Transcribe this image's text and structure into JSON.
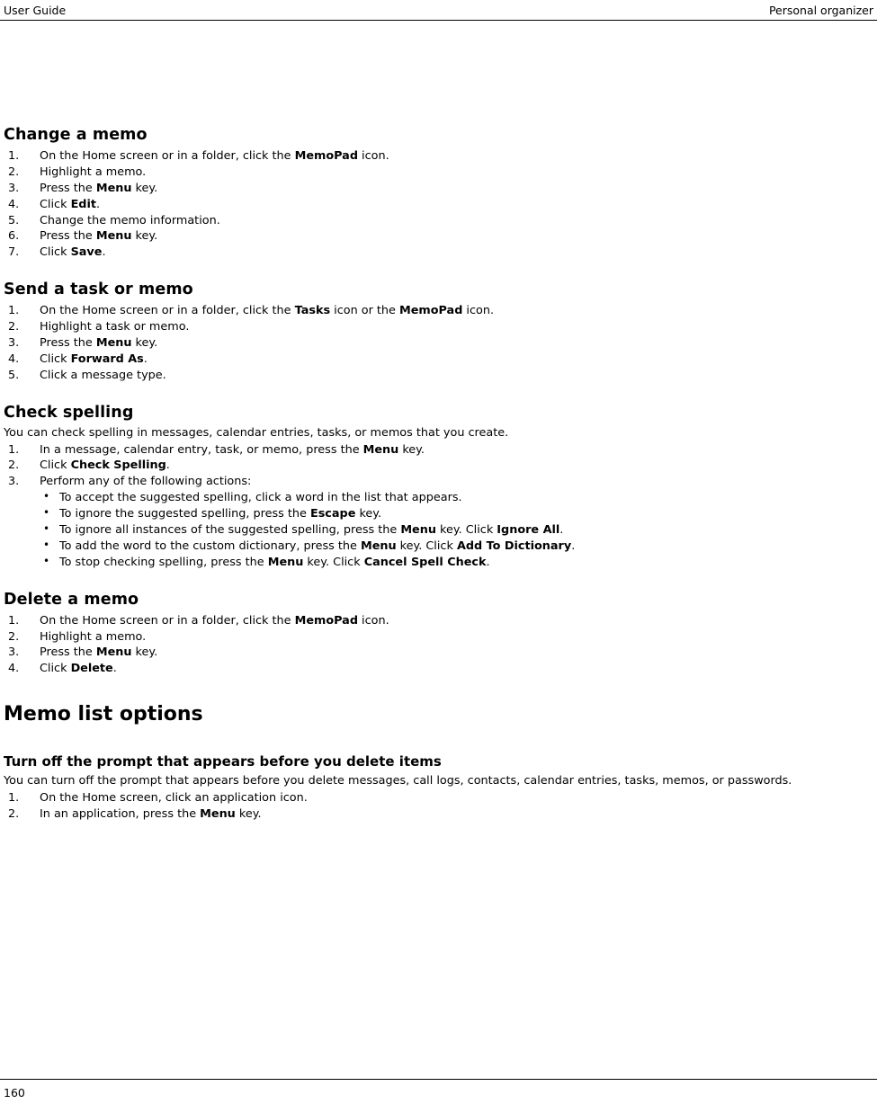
{
  "header": {
    "left": "User Guide",
    "right": "Personal organizer"
  },
  "footer": {
    "page_number": "160"
  },
  "sections": [
    {
      "id": "change_a_memo",
      "title": "Change a memo",
      "steps": [
        "On the Home screen or in a folder, click the MemoPad icon.",
        "Highlight a memo.",
        "Press the Menu key.",
        "Click Edit.",
        "Change the memo information.",
        "Press the Menu key.",
        "Click Save."
      ]
    },
    {
      "id": "send_a_task_or_memo",
      "title": "Send a task or memo",
      "steps": [
        "On the Home screen or in a folder, click the Tasks icon or the MemoPad icon.",
        "Highlight a task or memo.",
        "Press the Menu key.",
        "Click Forward As.",
        "Click a message type."
      ]
    },
    {
      "id": "check_spelling",
      "title": "Check spelling",
      "intro": "You can check spelling in messages, calendar entries, tasks, or memos that you create.",
      "steps": [
        "In a message, calendar entry, task, or memo, press the Menu key.",
        "Click Check Spelling.",
        "Perform any of the following actions:"
      ],
      "bullets": [
        "To accept the suggested spelling, click a word in the list that appears.",
        "To ignore the suggested spelling, press the Escape key.",
        "To ignore all instances of the suggested spelling, press the Menu key. Click Ignore All.",
        "To add the word to the custom dictionary, press the Menu key. Click Add To Dictionary.",
        "To stop checking spelling, press the Menu key. Click Cancel Spell Check."
      ]
    },
    {
      "id": "delete_a_memo",
      "title": "Delete a memo",
      "steps": [
        "On the Home screen or in a folder, click the MemoPad icon.",
        "Highlight a memo.",
        "Press the Menu key.",
        "Click Delete."
      ]
    }
  ],
  "major_section": {
    "title": "Memo list options",
    "subsection": {
      "title": "Turn off the prompt that appears before you delete items",
      "intro": "You can turn off the prompt that appears before you delete messages, call logs, contacts, calendar entries, tasks, memos, or passwords.",
      "steps": [
        "On the Home screen, click an application icon.",
        "In an application, press the Menu key."
      ]
    }
  },
  "inline_bold": {
    "memopad": "MemoPad",
    "menu": "Menu",
    "edit": "Edit",
    "save": "Save",
    "tasks": "Tasks",
    "forward_as": "Forward As",
    "check_spelling": "Check Spelling",
    "escape": "Escape",
    "ignore_all": "Ignore All",
    "add_to_dictionary": "Add To Dictionary",
    "cancel_spell_check": "Cancel Spell Check",
    "delete": "Delete"
  }
}
